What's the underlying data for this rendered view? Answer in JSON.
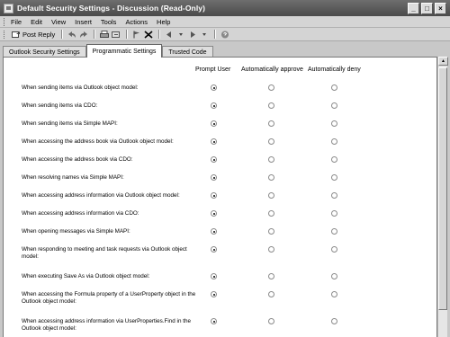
{
  "window": {
    "title": "Default Security Settings - Discussion  (Read-Only)",
    "minimize_glyph": "_",
    "maximize_glyph": "□",
    "close_glyph": "×"
  },
  "menu": [
    "File",
    "Edit",
    "View",
    "Insert",
    "Tools",
    "Actions",
    "Help"
  ],
  "toolbar": {
    "post_reply_label": "Post Reply"
  },
  "tabs": [
    {
      "label": "Outlook Security Settings",
      "active": false
    },
    {
      "label": "Programmatic Settings",
      "active": true
    },
    {
      "label": "Trusted Code",
      "active": false
    }
  ],
  "columns": {
    "prompt": "Prompt User",
    "approve": "Automatically approve",
    "deny": "Automatically deny"
  },
  "rows": [
    {
      "label": "When sending items via Outlook object model:",
      "selected": "prompt"
    },
    {
      "label": "When sending items via CDO:",
      "selected": "prompt"
    },
    {
      "label": "When sending items via Simple MAPI:",
      "selected": "prompt"
    },
    {
      "label": "When accessing the address book via Outlook object model:",
      "selected": "prompt"
    },
    {
      "label": "When accessing the address book via CDO:",
      "selected": "prompt"
    },
    {
      "label": "When resolving names via Simple MAPI:",
      "selected": "prompt"
    },
    {
      "label": "When accessing address information via Outlook object model:",
      "selected": "prompt"
    },
    {
      "label": "When accessing address information via CDO:",
      "selected": "prompt"
    },
    {
      "label": "When opening messages via Simple MAPI:",
      "selected": "prompt"
    },
    {
      "label": "When responding to meeting and task requests via Outlook object model:",
      "selected": "prompt"
    },
    {
      "label": "When executing Save As via Outlook object model:",
      "selected": "prompt"
    },
    {
      "label": "When accessing the Formula property of a UserProperty object in the Outlook object model:",
      "selected": "prompt"
    },
    {
      "label": "When accessing address information via UserProperties.Find in the Outlook object model:",
      "selected": "prompt"
    }
  ]
}
